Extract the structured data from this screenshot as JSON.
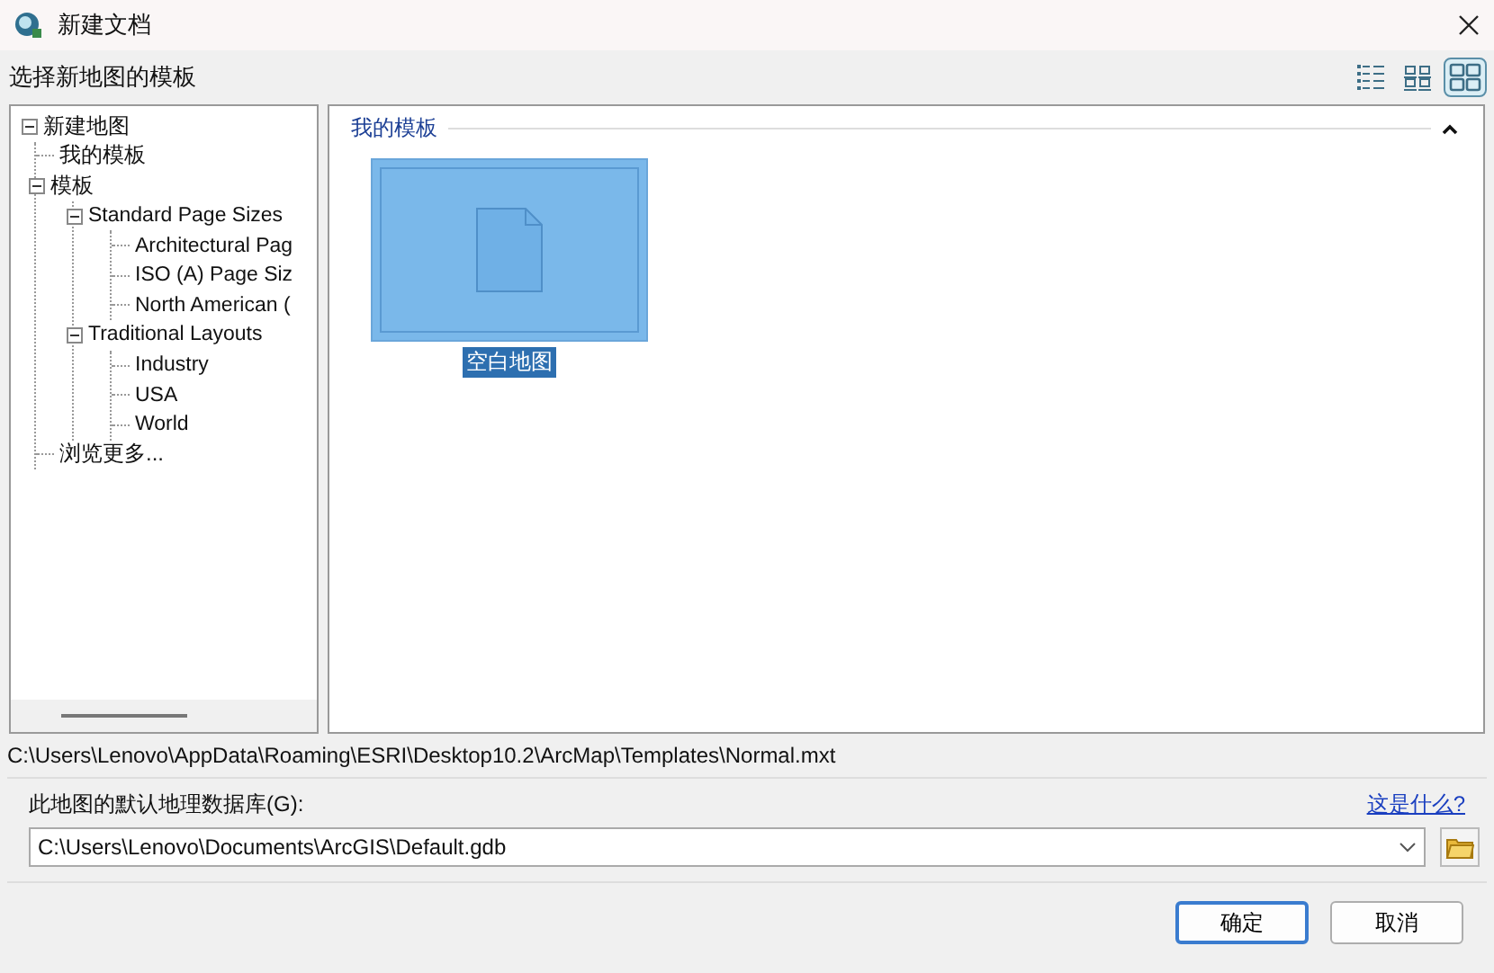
{
  "window": {
    "title": "新建文档"
  },
  "prompt": "选择新地图的模板",
  "view_buttons": [
    {
      "kind": "details",
      "selected": false
    },
    {
      "kind": "list",
      "selected": false
    },
    {
      "kind": "large",
      "selected": true
    }
  ],
  "tree": [
    {
      "label": "新建地图",
      "expanded": true,
      "children": [
        {
          "label": "我的模板"
        },
        {
          "label": "模板",
          "expanded": true,
          "children": [
            {
              "label": "Standard Page Sizes",
              "expanded": true,
              "children": [
                {
                  "label": "Architectural Pag"
                },
                {
                  "label": "ISO (A) Page Siz"
                },
                {
                  "label": "North American ("
                }
              ]
            },
            {
              "label": "Traditional Layouts",
              "expanded": true,
              "children": [
                {
                  "label": "Industry"
                },
                {
                  "label": "USA"
                },
                {
                  "label": "World"
                }
              ]
            }
          ]
        },
        {
          "label": "浏览更多..."
        }
      ]
    }
  ],
  "section": {
    "title": "我的模板",
    "expanded": true
  },
  "templates": [
    {
      "label": "空白地图",
      "selected": true
    }
  ],
  "path": "C:\\Users\\Lenovo\\AppData\\Roaming\\ESRI\\Desktop10.2\\ArcMap\\Templates\\Normal.mxt",
  "geodatabase": {
    "label": "此地图的默认地理数据库(G):",
    "link": "这是什么?",
    "value": "C:\\Users\\Lenovo\\Documents\\ArcGIS\\Default.gdb"
  },
  "buttons": [
    {
      "label": "确定",
      "default": true
    },
    {
      "label": "取消",
      "default": false
    }
  ]
}
